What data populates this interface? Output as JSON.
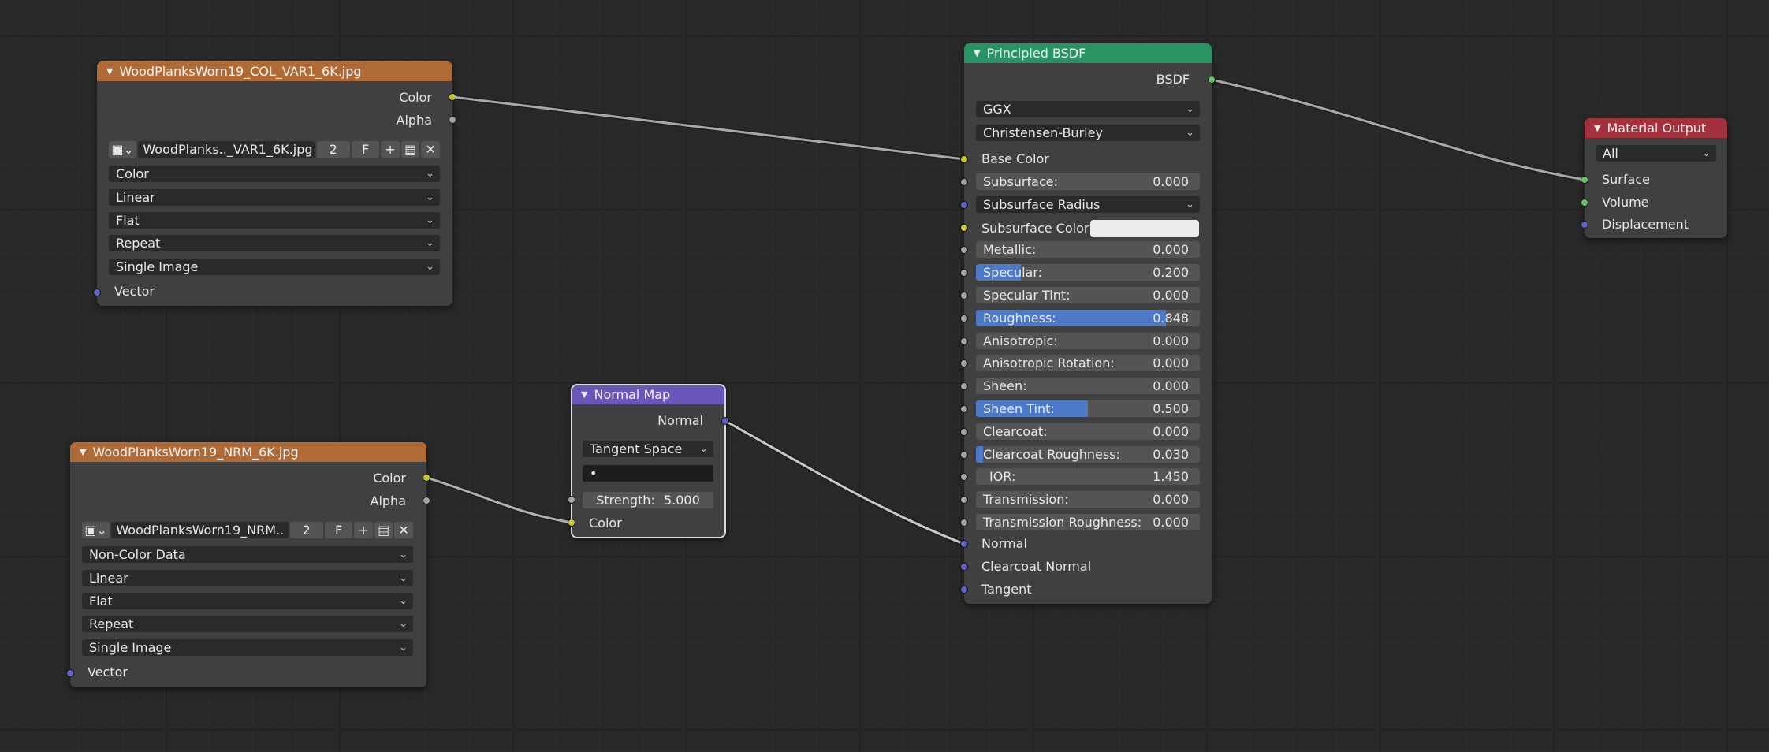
{
  "nodes": {
    "col_image": {
      "title": "WoodPlanksWorn19_COL_VAR1_6K.jpg",
      "outputs": [
        "Color",
        "Alpha"
      ],
      "image_name": "WoodPlanks.._VAR1_6K.jpg",
      "users": "2",
      "fake_user": "F",
      "color_space": "Color",
      "interpolation": "Linear",
      "projection": "Flat",
      "extension": "Repeat",
      "source": "Single Image",
      "input": "Vector"
    },
    "nrm_image": {
      "title": "WoodPlanksWorn19_NRM_6K.jpg",
      "outputs": [
        "Color",
        "Alpha"
      ],
      "image_name": "WoodPlanksWorn19_NRM..",
      "users": "2",
      "fake_user": "F",
      "color_space": "Non-Color Data",
      "interpolation": "Linear",
      "projection": "Flat",
      "extension": "Repeat",
      "source": "Single Image",
      "input": "Vector"
    },
    "normal_map": {
      "title": "Normal Map",
      "output": "Normal",
      "space": "Tangent Space",
      "uv_map": "•",
      "strength_label": "Strength:",
      "strength_value": "5.000",
      "input": "Color"
    },
    "bsdf": {
      "title": "Principled BSDF",
      "output": "BSDF",
      "distribution": "GGX",
      "subsurface_method": "Christensen-Burley",
      "base_color": "Base Color",
      "params": [
        {
          "label": "Subsurface:",
          "value": "0.000",
          "fill": 0
        },
        {
          "label": "Subsurface Radius",
          "type": "dropdown"
        },
        {
          "label": "Subsurface Color",
          "type": "color"
        },
        {
          "label": "Metallic:",
          "value": "0.000",
          "fill": 0
        },
        {
          "label": "Specular:",
          "value": "0.200",
          "fill": 0.2
        },
        {
          "label": "Specular Tint:",
          "value": "0.000",
          "fill": 0
        },
        {
          "label": "Roughness:",
          "value": "0.848",
          "fill": 0.848
        },
        {
          "label": "Anisotropic:",
          "value": "0.000",
          "fill": 0
        },
        {
          "label": "Anisotropic Rotation:",
          "value": "0.000",
          "fill": 0
        },
        {
          "label": "Sheen:",
          "value": "0.000",
          "fill": 0
        },
        {
          "label": "Sheen Tint:",
          "value": "0.500",
          "fill": 0.5
        },
        {
          "label": "Clearcoat:",
          "value": "0.000",
          "fill": 0
        },
        {
          "label": "Clearcoat Roughness:",
          "value": "0.030",
          "fill": 0.03
        },
        {
          "label": "IOR:",
          "value": "1.450",
          "fill": 0
        },
        {
          "label": "Transmission:",
          "value": "0.000",
          "fill": 0
        },
        {
          "label": "Transmission Roughness:",
          "value": "0.000",
          "fill": 0
        }
      ],
      "inputs_tail": [
        "Normal",
        "Clearcoat Normal",
        "Tangent"
      ]
    },
    "output": {
      "title": "Material Output",
      "target": "All",
      "inputs": [
        "Surface",
        "Volume",
        "Displacement"
      ]
    }
  },
  "colors": {
    "socket_color": "#c7c729",
    "socket_float": "#a1a1a1",
    "socket_vector": "#6363c7",
    "socket_shader": "#63c763",
    "slider_fill": "#4c79c8"
  }
}
